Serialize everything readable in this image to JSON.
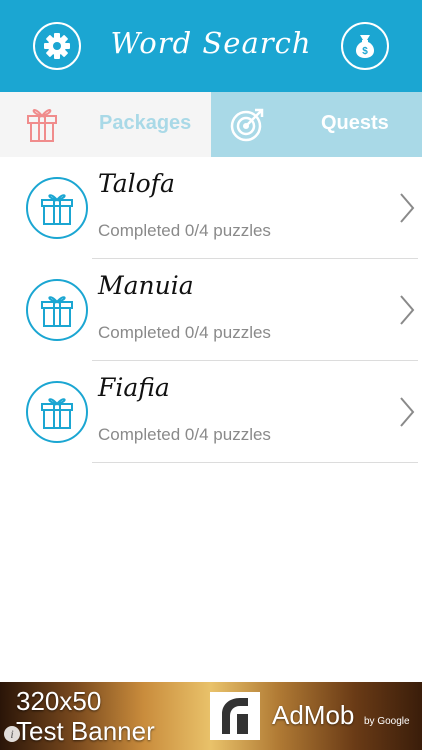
{
  "header": {
    "title": "Word Search",
    "settings_icon": "gear-icon",
    "shop_icon": "money-bag-icon",
    "background_color": "#1ba6d2"
  },
  "tabs": [
    {
      "label": "Packages",
      "icon": "gift-icon",
      "active": true,
      "icon_color": "#f08c8c"
    },
    {
      "label": "Quests",
      "icon": "target-arrow-icon",
      "active": false
    }
  ],
  "packages": [
    {
      "name": "Talofa",
      "status": "Completed 0/4 puzzles",
      "icon": "gift-icon"
    },
    {
      "name": "Manuia",
      "status": "Completed 0/4 puzzles",
      "icon": "gift-icon"
    },
    {
      "name": "Fiafia",
      "status": "Completed 0/4 puzzles",
      "icon": "gift-icon"
    }
  ],
  "ad": {
    "line1": "320x50",
    "line2": "Test Banner",
    "brand": "AdMob",
    "by": "by Google",
    "info_icon": "info-icon"
  }
}
